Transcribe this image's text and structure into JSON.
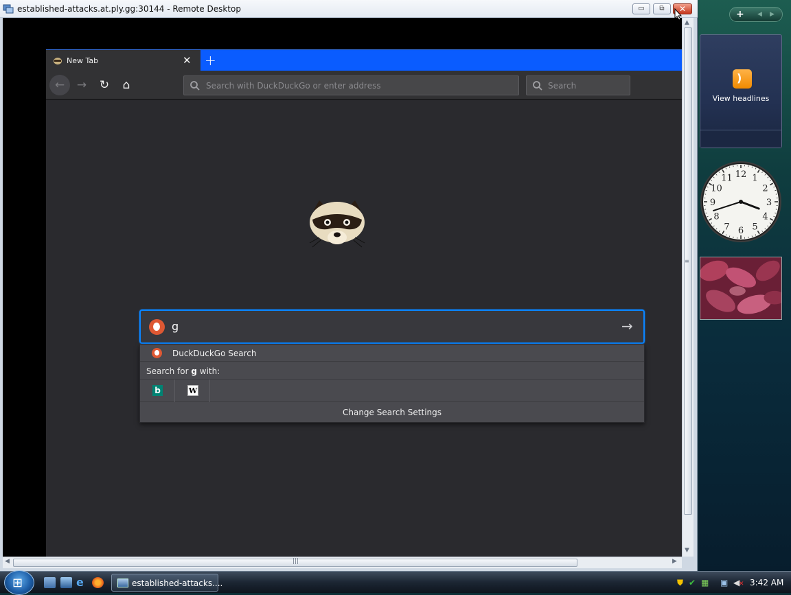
{
  "rdp_window": {
    "title": "established-attacks.at.ply.gg:30144 - Remote Desktop",
    "minimize_glyph": "▭",
    "maximize_glyph": "⧉",
    "close_glyph": "✕"
  },
  "browser": {
    "tab": {
      "label": "New Tab",
      "favicon": "raccoon-icon",
      "close_glyph": "✕"
    },
    "new_tab_glyph": "+",
    "nav": {
      "back_glyph": "←",
      "forward_glyph": "→",
      "reload_glyph": "↻",
      "home_glyph": "⌂"
    },
    "urlbar": {
      "placeholder": "Search with DuckDuckGo or enter address"
    },
    "searchbar": {
      "placeholder": "Search"
    },
    "newtab_search": {
      "query": "g",
      "go_glyph": "→"
    },
    "suggestions": {
      "default_engine_label": "DuckDuckGo Search",
      "search_for_prefix": "Search for ",
      "search_for_term": "g",
      "search_for_suffix": " with:",
      "engines": [
        {
          "name": "bing",
          "glyph": "b",
          "icon": "bing-icon"
        },
        {
          "name": "wikipedia",
          "glyph": "W",
          "icon": "wikipedia-icon"
        }
      ],
      "change_settings_label": "Change Search Settings"
    }
  },
  "sidebar": {
    "controls": {
      "add_glyph": "+",
      "prev_glyph": "◀",
      "next_glyph": "▶"
    },
    "feed_gadget": {
      "label": "View headlines",
      "icon": "rss-icon"
    },
    "clock_gadget": {
      "numerals": [
        "12",
        "1",
        "2",
        "3",
        "4",
        "5",
        "6",
        "7",
        "8",
        "9",
        "10",
        "11"
      ],
      "hour": 3,
      "minute": 42
    }
  },
  "taskbar": {
    "start_glyph": "⊞",
    "task_label": "established-attacks....",
    "clock": "3:42 AM",
    "colors": {
      "taskbar": "#1c2633",
      "accent": "#0a84ff"
    }
  }
}
